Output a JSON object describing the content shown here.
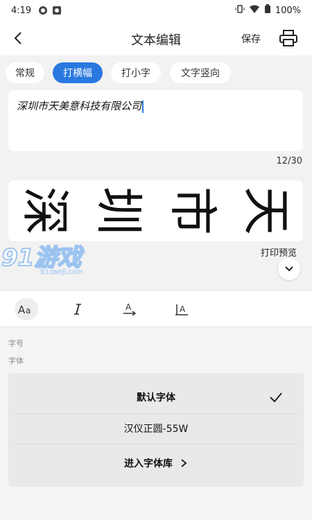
{
  "status": {
    "time": "4:19",
    "battery": "100%"
  },
  "header": {
    "title": "文本编辑",
    "save": "保存"
  },
  "tabs": [
    {
      "label": "常规"
    },
    {
      "label": "打横幅",
      "active": true
    },
    {
      "label": "打小字"
    },
    {
      "label": "文字竖向"
    }
  ],
  "editor": {
    "value": "深圳市天美意科技有限公司",
    "counter": "12/30"
  },
  "preview": {
    "chars": [
      "深",
      "圳",
      "市",
      "天"
    ],
    "label": "打印预览"
  },
  "watermark": {
    "text": "91游戏",
    "sub": "91danji.com"
  },
  "format": {
    "size_label": "字号",
    "font_label": "字体"
  },
  "fonts": {
    "items": [
      {
        "label": "默认字体",
        "selected": true
      },
      {
        "label": "汉仪正圆-55W"
      }
    ],
    "library": "进入字体库"
  },
  "colors": {
    "accent": "#2979e0"
  }
}
